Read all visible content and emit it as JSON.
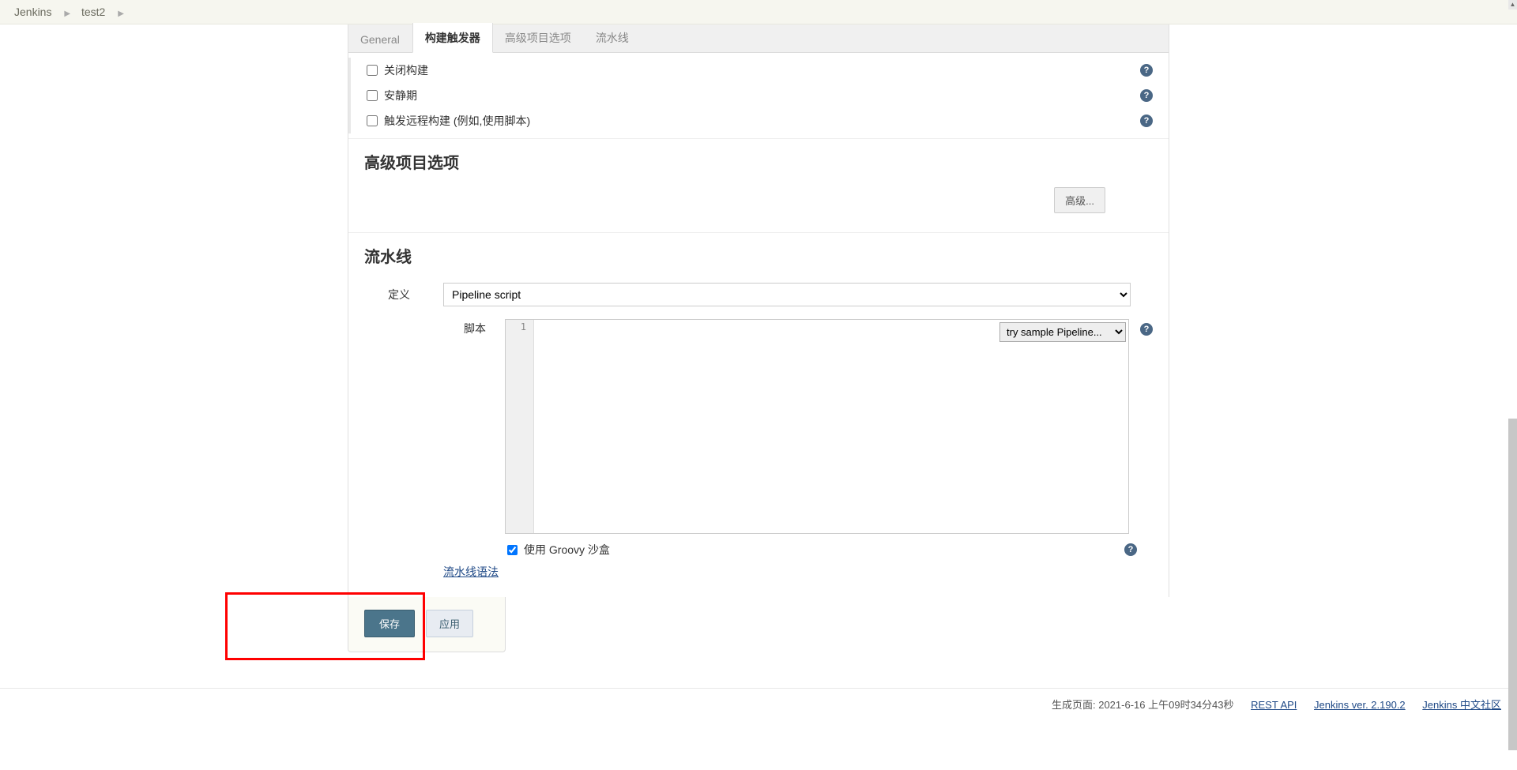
{
  "breadcrumb": {
    "items": [
      "Jenkins",
      "test2"
    ]
  },
  "tabs": [
    {
      "label": "General",
      "active": false
    },
    {
      "label": "构建触发器",
      "active": true
    },
    {
      "label": "高级项目选项",
      "active": false
    },
    {
      "label": "流水线",
      "active": false
    }
  ],
  "trigger_options": [
    {
      "label": "关闭构建",
      "checked": false,
      "help": true
    },
    {
      "label": "安静期",
      "checked": false,
      "help": true
    },
    {
      "label": "触发远程构建 (例如,使用脚本)",
      "checked": false,
      "help": true
    }
  ],
  "sections": {
    "advanced_heading": "高级项目选项",
    "advanced_button": "高级...",
    "pipeline_heading": "流水线"
  },
  "pipeline": {
    "definition_label": "定义",
    "definition_value": "Pipeline script",
    "script_label": "脚本",
    "gutter_line": "1",
    "sample_select": "try sample Pipeline...",
    "sandbox_label": "使用 Groovy 沙盒",
    "sandbox_checked": true,
    "syntax_link": "流水线语法"
  },
  "buttons": {
    "save": "保存",
    "apply": "应用"
  },
  "footer": {
    "gen_text": "生成页面: 2021-6-16 上午09时34分43秒",
    "rest_api": "REST API",
    "version": "Jenkins ver. 2.190.2",
    "community": "Jenkins 中文社区"
  }
}
